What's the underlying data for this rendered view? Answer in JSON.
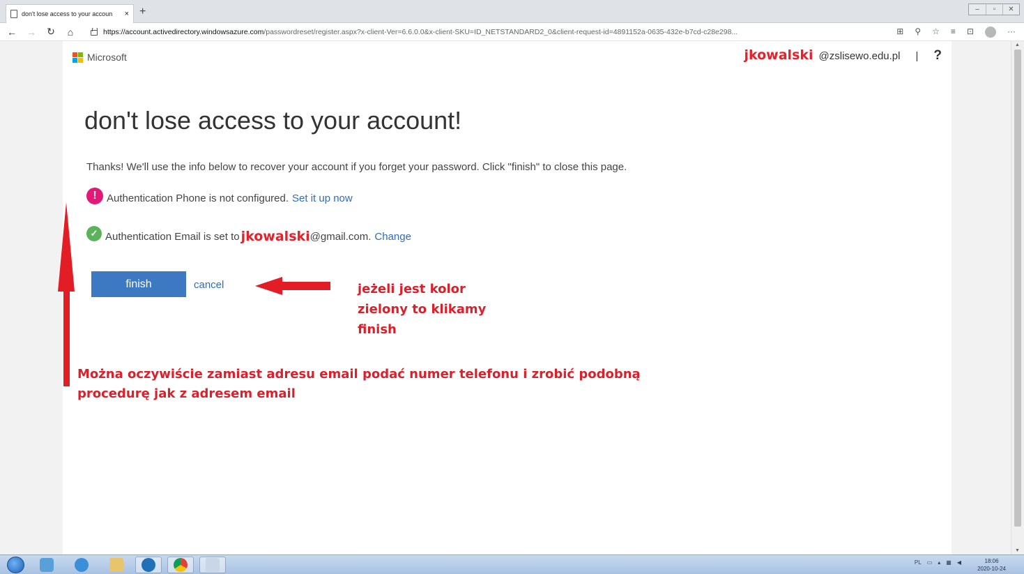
{
  "browser": {
    "tab_title": "don't lose access to your accoun",
    "tab_close": "×",
    "new_tab": "+",
    "url_host": "https://account.activedirectory.windowsazure.com",
    "url_rest": "/passwordreset/register.aspx?x-client-Ver=6.6.0.0&x-client-SKU=ID_NETSTANDARD2_0&client-request-id=4891152a-0635-432e-b7cd-c28e298...",
    "back": "←",
    "forward": "→",
    "refresh": "↻",
    "home": "⌂"
  },
  "header": {
    "brand": "Microsoft",
    "user_name": "jkowalski",
    "user_domain": "@zslisewo.edu.pl",
    "separator": "|",
    "help": "?"
  },
  "main": {
    "title": "don't lose access to your account!",
    "intro": "Thanks! We'll use the info below to recover your account if you forget your password. Click \"finish\" to close this page.",
    "phone": {
      "icon_glyph": "!",
      "text": "Authentication Phone is not configured.",
      "link": "Set it up now"
    },
    "email": {
      "icon_glyph": "✓",
      "text_before": "Authentication Email is set to",
      "user": "jkowalski",
      "text_after": "@gmail.com.",
      "link": "Change"
    },
    "finish_label": "finish",
    "cancel_label": "cancel"
  },
  "annotations": {
    "side_note": [
      "jeżeli jest kolor",
      "zielony to klikamy",
      "finish"
    ],
    "bottom_note": [
      "Można oczywiście zamiast adresu email podać numer telefonu i zrobić podobną",
      "procedurę jak z adresem email"
    ]
  },
  "taskbar": {
    "lang": "PL",
    "time": "18:06",
    "date": "2020-10-24"
  },
  "colors": {
    "accent_blue": "#3d79c3",
    "link_blue": "#2f6db5",
    "error_pink": "#e3197a",
    "success_green": "#5bb25a",
    "annotation_red": "#d9202b"
  }
}
